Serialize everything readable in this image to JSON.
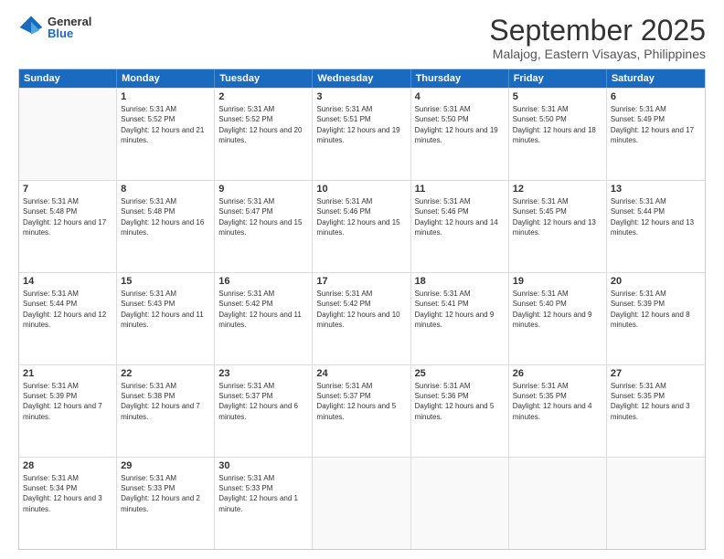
{
  "logo": {
    "general": "General",
    "blue": "Blue"
  },
  "title": "September 2025",
  "location": "Malajog, Eastern Visayas, Philippines",
  "days": [
    "Sunday",
    "Monday",
    "Tuesday",
    "Wednesday",
    "Thursday",
    "Friday",
    "Saturday"
  ],
  "weeks": [
    [
      {
        "day": "",
        "empty": true
      },
      {
        "day": "1",
        "sunrise": "Sunrise: 5:31 AM",
        "sunset": "Sunset: 5:52 PM",
        "daylight": "Daylight: 12 hours and 21 minutes."
      },
      {
        "day": "2",
        "sunrise": "Sunrise: 5:31 AM",
        "sunset": "Sunset: 5:52 PM",
        "daylight": "Daylight: 12 hours and 20 minutes."
      },
      {
        "day": "3",
        "sunrise": "Sunrise: 5:31 AM",
        "sunset": "Sunset: 5:51 PM",
        "daylight": "Daylight: 12 hours and 19 minutes."
      },
      {
        "day": "4",
        "sunrise": "Sunrise: 5:31 AM",
        "sunset": "Sunset: 5:50 PM",
        "daylight": "Daylight: 12 hours and 19 minutes."
      },
      {
        "day": "5",
        "sunrise": "Sunrise: 5:31 AM",
        "sunset": "Sunset: 5:50 PM",
        "daylight": "Daylight: 12 hours and 18 minutes."
      },
      {
        "day": "6",
        "sunrise": "Sunrise: 5:31 AM",
        "sunset": "Sunset: 5:49 PM",
        "daylight": "Daylight: 12 hours and 17 minutes."
      }
    ],
    [
      {
        "day": "7",
        "sunrise": "Sunrise: 5:31 AM",
        "sunset": "Sunset: 5:48 PM",
        "daylight": "Daylight: 12 hours and 17 minutes."
      },
      {
        "day": "8",
        "sunrise": "Sunrise: 5:31 AM",
        "sunset": "Sunset: 5:48 PM",
        "daylight": "Daylight: 12 hours and 16 minutes."
      },
      {
        "day": "9",
        "sunrise": "Sunrise: 5:31 AM",
        "sunset": "Sunset: 5:47 PM",
        "daylight": "Daylight: 12 hours and 15 minutes."
      },
      {
        "day": "10",
        "sunrise": "Sunrise: 5:31 AM",
        "sunset": "Sunset: 5:46 PM",
        "daylight": "Daylight: 12 hours and 15 minutes."
      },
      {
        "day": "11",
        "sunrise": "Sunrise: 5:31 AM",
        "sunset": "Sunset: 5:46 PM",
        "daylight": "Daylight: 12 hours and 14 minutes."
      },
      {
        "day": "12",
        "sunrise": "Sunrise: 5:31 AM",
        "sunset": "Sunset: 5:45 PM",
        "daylight": "Daylight: 12 hours and 13 minutes."
      },
      {
        "day": "13",
        "sunrise": "Sunrise: 5:31 AM",
        "sunset": "Sunset: 5:44 PM",
        "daylight": "Daylight: 12 hours and 13 minutes."
      }
    ],
    [
      {
        "day": "14",
        "sunrise": "Sunrise: 5:31 AM",
        "sunset": "Sunset: 5:44 PM",
        "daylight": "Daylight: 12 hours and 12 minutes."
      },
      {
        "day": "15",
        "sunrise": "Sunrise: 5:31 AM",
        "sunset": "Sunset: 5:43 PM",
        "daylight": "Daylight: 12 hours and 11 minutes."
      },
      {
        "day": "16",
        "sunrise": "Sunrise: 5:31 AM",
        "sunset": "Sunset: 5:42 PM",
        "daylight": "Daylight: 12 hours and 11 minutes."
      },
      {
        "day": "17",
        "sunrise": "Sunrise: 5:31 AM",
        "sunset": "Sunset: 5:42 PM",
        "daylight": "Daylight: 12 hours and 10 minutes."
      },
      {
        "day": "18",
        "sunrise": "Sunrise: 5:31 AM",
        "sunset": "Sunset: 5:41 PM",
        "daylight": "Daylight: 12 hours and 9 minutes."
      },
      {
        "day": "19",
        "sunrise": "Sunrise: 5:31 AM",
        "sunset": "Sunset: 5:40 PM",
        "daylight": "Daylight: 12 hours and 9 minutes."
      },
      {
        "day": "20",
        "sunrise": "Sunrise: 5:31 AM",
        "sunset": "Sunset: 5:39 PM",
        "daylight": "Daylight: 12 hours and 8 minutes."
      }
    ],
    [
      {
        "day": "21",
        "sunrise": "Sunrise: 5:31 AM",
        "sunset": "Sunset: 5:39 PM",
        "daylight": "Daylight: 12 hours and 7 minutes."
      },
      {
        "day": "22",
        "sunrise": "Sunrise: 5:31 AM",
        "sunset": "Sunset: 5:38 PM",
        "daylight": "Daylight: 12 hours and 7 minutes."
      },
      {
        "day": "23",
        "sunrise": "Sunrise: 5:31 AM",
        "sunset": "Sunset: 5:37 PM",
        "daylight": "Daylight: 12 hours and 6 minutes."
      },
      {
        "day": "24",
        "sunrise": "Sunrise: 5:31 AM",
        "sunset": "Sunset: 5:37 PM",
        "daylight": "Daylight: 12 hours and 5 minutes."
      },
      {
        "day": "25",
        "sunrise": "Sunrise: 5:31 AM",
        "sunset": "Sunset: 5:36 PM",
        "daylight": "Daylight: 12 hours and 5 minutes."
      },
      {
        "day": "26",
        "sunrise": "Sunrise: 5:31 AM",
        "sunset": "Sunset: 5:35 PM",
        "daylight": "Daylight: 12 hours and 4 minutes."
      },
      {
        "day": "27",
        "sunrise": "Sunrise: 5:31 AM",
        "sunset": "Sunset: 5:35 PM",
        "daylight": "Daylight: 12 hours and 3 minutes."
      }
    ],
    [
      {
        "day": "28",
        "sunrise": "Sunrise: 5:31 AM",
        "sunset": "Sunset: 5:34 PM",
        "daylight": "Daylight: 12 hours and 3 minutes."
      },
      {
        "day": "29",
        "sunrise": "Sunrise: 5:31 AM",
        "sunset": "Sunset: 5:33 PM",
        "daylight": "Daylight: 12 hours and 2 minutes."
      },
      {
        "day": "30",
        "sunrise": "Sunrise: 5:31 AM",
        "sunset": "Sunset: 5:33 PM",
        "daylight": "Daylight: 12 hours and 1 minute."
      },
      {
        "day": "",
        "empty": true
      },
      {
        "day": "",
        "empty": true
      },
      {
        "day": "",
        "empty": true
      },
      {
        "day": "",
        "empty": true
      }
    ]
  ]
}
